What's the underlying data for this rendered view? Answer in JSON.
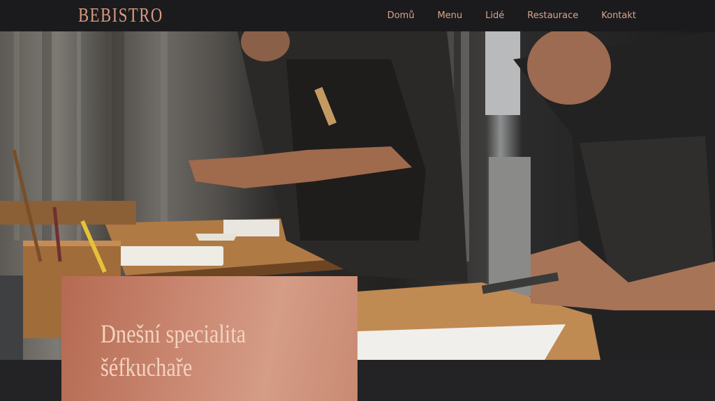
{
  "header": {
    "logo": "BEBISTRO",
    "nav": [
      {
        "label": "Domů"
      },
      {
        "label": "Menu"
      },
      {
        "label": "Lidé"
      },
      {
        "label": "Restaurace"
      },
      {
        "label": "Kontakt"
      }
    ]
  },
  "hero": {
    "image": "chefs-plating-food-photo"
  },
  "special": {
    "title_line1": "Dnešní specialita",
    "title_line2": "šéfkuchaře"
  },
  "colors": {
    "accent": "#d9a48a",
    "header_bg": "#1b1b1d",
    "card": "#c98670"
  }
}
